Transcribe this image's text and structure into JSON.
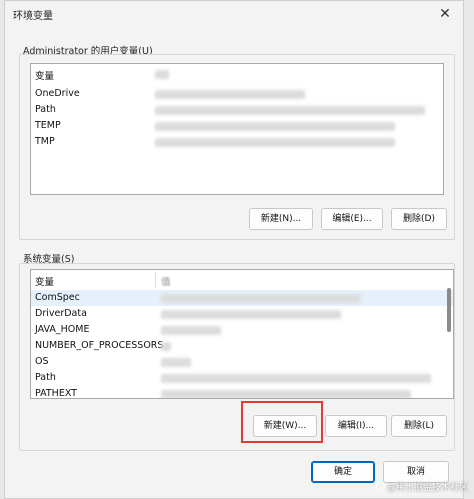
{
  "window": {
    "title": "环境变量"
  },
  "user_vars": {
    "group_label": "Administrator 的用户变量(U)",
    "header": {
      "name": "变量"
    },
    "rows": [
      {
        "name": "OneDrive"
      },
      {
        "name": "Path"
      },
      {
        "name": "TEMP"
      },
      {
        "name": "TMP"
      }
    ],
    "buttons": {
      "new": "新建(N)...",
      "edit": "编辑(E)...",
      "delete": "删除(D)"
    }
  },
  "system_vars": {
    "group_label": "系统变量(S)",
    "header": {
      "name": "变量",
      "value": "值"
    },
    "rows": [
      {
        "name": "ComSpec"
      },
      {
        "name": "DriverData"
      },
      {
        "name": "JAVA_HOME"
      },
      {
        "name": "NUMBER_OF_PROCESSORS"
      },
      {
        "name": "OS"
      },
      {
        "name": "Path"
      },
      {
        "name": "PATHEXT"
      }
    ],
    "buttons": {
      "new": "新建(W)...",
      "edit": "编辑(I)...",
      "delete": "删除(L)"
    }
  },
  "footer": {
    "ok": "确定",
    "cancel": "取消"
  },
  "watermark": "@稀土掘金技术社区",
  "colors": {
    "highlight": "#e53935",
    "primary_border": "#0067c0",
    "selected_row": "#e5f0fb"
  }
}
